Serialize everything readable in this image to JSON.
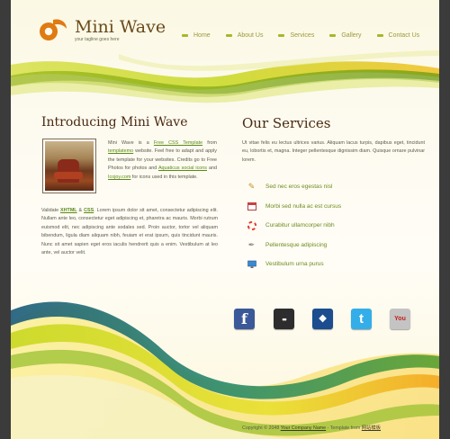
{
  "header": {
    "site_title": "Mini Wave",
    "tagline": "your tagline goes here"
  },
  "nav": {
    "items": [
      {
        "label": "Home"
      },
      {
        "label": "About Us"
      },
      {
        "label": "Services"
      },
      {
        "label": "Gallery"
      },
      {
        "label": "Contact Us"
      }
    ]
  },
  "intro": {
    "title": "Introducing Mini Wave",
    "p1_a": "Mini Wave is a ",
    "p1_link1": "Free CSS Template",
    "p1_b": " from ",
    "p1_link2": "templatemo",
    "p1_c": " website. Feel free to adapt and apply the template for your websites. Credits go to Free Photos for photos and ",
    "p1_link3": "Aquaticus social icons",
    "p1_d": " and ",
    "p1_link4": "Icojoy.com",
    "p1_e": " for icons used in this template.",
    "p2_a": "Validate ",
    "p2_link1": "XHTML",
    "p2_b": " & ",
    "p2_link2": "CSS",
    "p2_c": ". Lorem ipsum dolor sit amet, consectetur adipiscing elit. Nullam ante leo, consectetur eget adipiscing et, pharetra ac mauris. Morbi rutrum euismod elit, nec adipiscing ante sodales sed. Proin auctor, tortor vel aliquam bibendum, ligula diam aliquam nibh, feuiam et erat ipsum, quis tincidunt mauris. Nunc sit amet sapien eget eros iaculis hendrerit quis a enim. Vestibulum at leo ante, vel auctor velit."
  },
  "services": {
    "title": "Our Services",
    "text": "Ut vitae felis eu lectus ultrices varius. Aliquam lacus turpis, dapibus eget, tincidunt eu, lobortis et, magna. Integer pellentesque dignissim diam. Quisque ornare pulvinar lorem.",
    "items": [
      {
        "label": "Sed nec eros egestas nisl",
        "icon": "tools-icon"
      },
      {
        "label": "Morbi sed nulla ac est cursus",
        "icon": "calendar-icon"
      },
      {
        "label": "Curabitur ullamcorper nibh",
        "icon": "lifebuoy-icon"
      },
      {
        "label": "Pellentesque adipiscing",
        "icon": "pen-icon"
      },
      {
        "label": "Vestibulum urna purus",
        "icon": "monitor-icon"
      }
    ]
  },
  "social": [
    {
      "name": "facebook",
      "glyph": "f",
      "color": "#3b5998"
    },
    {
      "name": "flickr",
      "glyph": "••",
      "color": "#2d2d2d"
    },
    {
      "name": "myspace",
      "glyph": "❖",
      "color": "#1b4d8f"
    },
    {
      "name": "twitter",
      "glyph": "t",
      "color": "#33aee8"
    },
    {
      "name": "youtube",
      "glyph": "You",
      "color": "#b3b3b3"
    }
  ],
  "footer": {
    "copyright": "Copyright © 2048 ",
    "company": "Your Company Name",
    "template_from": " - Template from ",
    "site": "网站模板"
  },
  "colors": {
    "accent_green": "#a5b82c",
    "brand_orange": "#e07a12",
    "heading_brown": "#4a2a12",
    "link_green": "#5a8a14"
  }
}
